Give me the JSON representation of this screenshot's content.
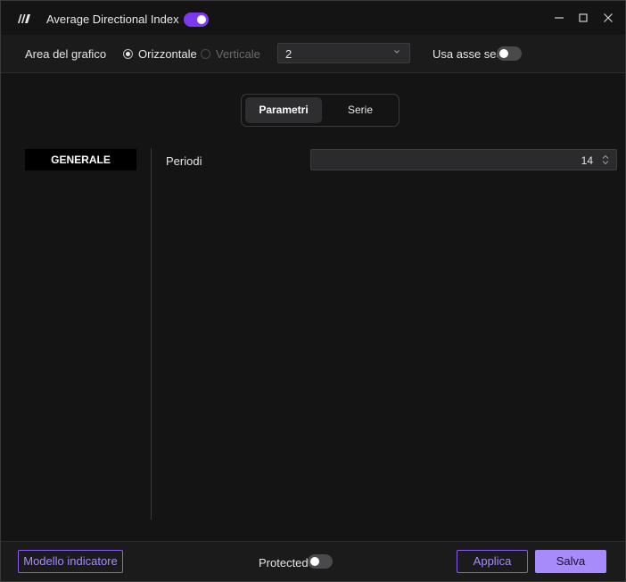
{
  "window": {
    "title": "Average Directional Index",
    "indicator_enabled": true
  },
  "header": {
    "chart_area_label": "Area del grafico",
    "orientation_options": [
      {
        "label": "Orizzontale",
        "selected": true,
        "disabled": false
      },
      {
        "label": "Verticale",
        "selected": false,
        "disabled": true
      }
    ],
    "pane_select_value": "2",
    "secondary_axis_label": "Usa asse sec.",
    "secondary_axis_enabled": false
  },
  "tabs": [
    {
      "label": "Parametri",
      "active": true
    },
    {
      "label": "Serie",
      "active": false
    }
  ],
  "sidebar": {
    "items": [
      {
        "label": "GENERALE",
        "active": true
      }
    ]
  },
  "params": [
    {
      "label": "Periodi",
      "value": "14"
    }
  ],
  "footer": {
    "template_button": "Modello indicatore",
    "protected_label": "Protected",
    "protected_enabled": false,
    "apply_button": "Applica",
    "save_button": "Salva"
  },
  "colors": {
    "accent": "#7c3aed",
    "accent_light": "#a78bfa",
    "background": "#141415",
    "panel": "#1b1b1c"
  }
}
